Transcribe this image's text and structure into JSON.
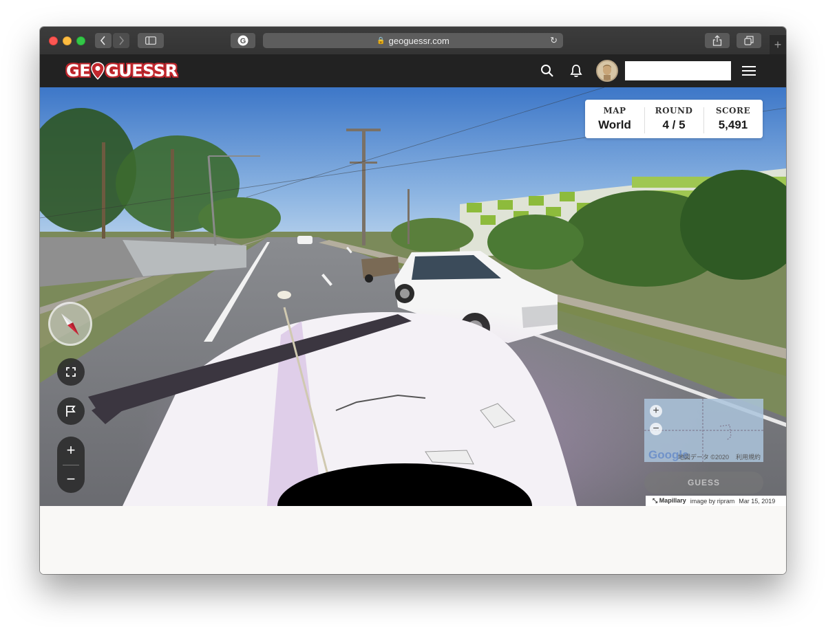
{
  "browser": {
    "url": "geoguessr.com",
    "lock_icon": "lock-icon",
    "reload_icon": "reload-icon"
  },
  "header": {
    "logo_text_left": "GE",
    "logo_text_right": "GUESSR",
    "brand_color": "#c1272d"
  },
  "status": {
    "map_label": "MAP",
    "map_value": "World",
    "round_label": "ROUND",
    "round_value": "4 / 5",
    "score_label": "SCORE",
    "score_value": "5,491"
  },
  "controls": {
    "zoom_in": "+",
    "zoom_out": "−"
  },
  "minimap": {
    "zoom_in": "+",
    "zoom_out": "−",
    "google_logo": "Google",
    "map_data": "地図データ ©2020",
    "terms": "利用規約"
  },
  "guess_button": "GUESS",
  "attribution": {
    "provider": "Mapillary",
    "credit": "image by ripram",
    "date": "Mar 15, 2019"
  }
}
